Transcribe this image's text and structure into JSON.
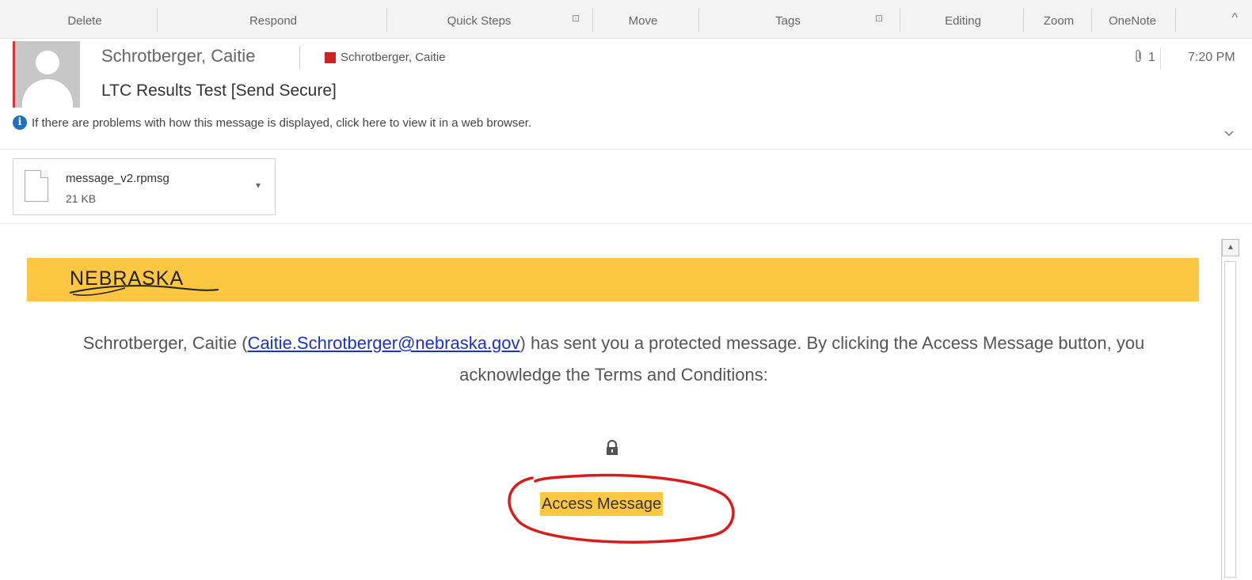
{
  "ribbon": {
    "groups": [
      "Delete",
      "Respond",
      "Quick Steps",
      "Move",
      "Tags",
      "Editing",
      "Zoom",
      "OneNote"
    ],
    "launcher_glyph": "⊡",
    "collapse_glyph": "^"
  },
  "header": {
    "sender": "Schrotberger, Caitie",
    "recipient": "Schrotberger, Caitie",
    "subject": "LTC Results Test [Send Secure]",
    "attachment_count": "1",
    "time": "7:20 PM",
    "info_message": "If there are problems with how this message is displayed, click here to view it in a web browser."
  },
  "attachment": {
    "name": "message_v2.rpmsg",
    "size": "21 KB"
  },
  "message": {
    "logo_text": "NEBRASKA",
    "text_prefix": "Schrotberger, Caitie (",
    "email": "Caitie.Schrotberger@nebraska.gov",
    "text_suffix": ") has sent you a protected message. By clicking the Access Message button, you acknowledge the Terms and Conditions:",
    "access_button": "Access Message"
  },
  "colors": {
    "banner": "#fdc742",
    "link": "#1a33cc",
    "annotation_circle": "#d81b1b",
    "info_icon": "#1f6fc3"
  }
}
